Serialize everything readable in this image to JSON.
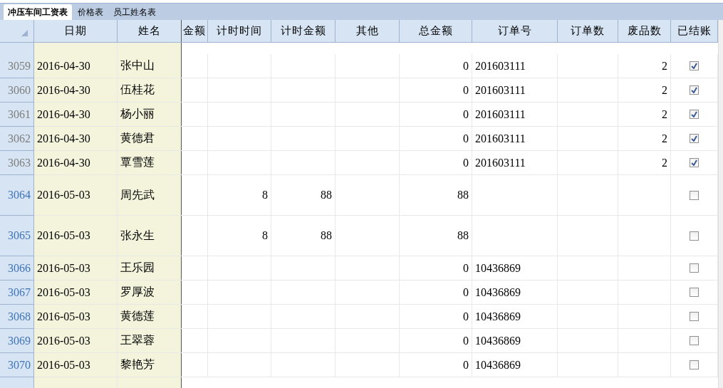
{
  "tabs": [
    {
      "label": "冲压车间工资表",
      "selected": true
    },
    {
      "label": "价格表",
      "selected": false
    },
    {
      "label": "员工姓名表",
      "selected": false
    }
  ],
  "columns": [
    "日期",
    "姓名",
    "金额",
    "计时时间",
    "计时金额",
    "其他",
    "总金额",
    "订单号",
    "订单数",
    "废品数",
    "已结账"
  ],
  "rows": [
    {
      "number": "3059",
      "greyed": true,
      "tall": false,
      "cells": [
        "2016-04-30",
        "张中山",
        "",
        "",
        "",
        "",
        "0",
        "201603111",
        "",
        "2"
      ],
      "checked": true
    },
    {
      "number": "3060",
      "greyed": true,
      "tall": false,
      "cells": [
        "2016-04-30",
        "伍桂花",
        "",
        "",
        "",
        "",
        "0",
        "201603111",
        "",
        "2"
      ],
      "checked": true
    },
    {
      "number": "3061",
      "greyed": true,
      "tall": false,
      "cells": [
        "2016-04-30",
        "杨小丽",
        "",
        "",
        "",
        "",
        "0",
        "201603111",
        "",
        "2"
      ],
      "checked": true
    },
    {
      "number": "3062",
      "greyed": true,
      "tall": false,
      "cells": [
        "2016-04-30",
        "黄德君",
        "",
        "",
        "",
        "",
        "0",
        "201603111",
        "",
        "2"
      ],
      "checked": true
    },
    {
      "number": "3063",
      "greyed": true,
      "tall": false,
      "cells": [
        "2016-04-30",
        "覃雪莲",
        "",
        "",
        "",
        "",
        "0",
        "201603111",
        "",
        "2"
      ],
      "checked": true
    },
    {
      "number": "3064",
      "greyed": false,
      "tall": true,
      "cells": [
        "2016-05-03",
        "周先武",
        "",
        "8",
        "88",
        "",
        "88",
        "",
        "",
        ""
      ],
      "checked": false
    },
    {
      "number": "3065",
      "greyed": false,
      "tall": true,
      "cells": [
        "2016-05-03",
        "张永生",
        "",
        "8",
        "88",
        "",
        "88",
        "",
        "",
        ""
      ],
      "checked": false
    },
    {
      "number": "3066",
      "greyed": false,
      "tall": false,
      "cells": [
        "2016-05-03",
        "王乐园",
        "",
        "",
        "",
        "",
        "0",
        "10436869",
        "",
        ""
      ],
      "checked": false
    },
    {
      "number": "3067",
      "greyed": false,
      "tall": false,
      "cells": [
        "2016-05-03",
        "罗厚波",
        "",
        "",
        "",
        "",
        "0",
        "10436869",
        "",
        ""
      ],
      "checked": false
    },
    {
      "number": "3068",
      "greyed": false,
      "tall": false,
      "cells": [
        "2016-05-03",
        "黄德莲",
        "",
        "",
        "",
        "",
        "0",
        "10436869",
        "",
        ""
      ],
      "checked": false
    },
    {
      "number": "3069",
      "greyed": false,
      "tall": false,
      "cells": [
        "2016-05-03",
        "王翠蓉",
        "",
        "",
        "",
        "",
        "0",
        "10436869",
        "",
        ""
      ],
      "checked": false
    },
    {
      "number": "3070",
      "greyed": false,
      "tall": false,
      "cells": [
        "2016-05-03",
        "黎艳芳",
        "",
        "",
        "",
        "",
        "0",
        "10436869",
        "",
        ""
      ],
      "checked": false
    }
  ]
}
